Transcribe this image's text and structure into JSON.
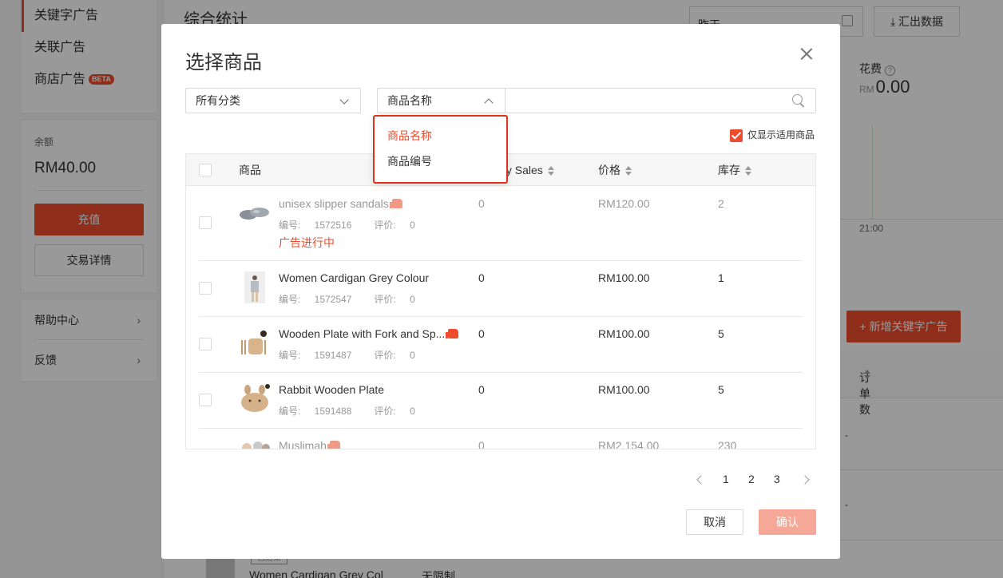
{
  "sidebar": {
    "nav": [
      {
        "label": "关键字广告"
      },
      {
        "label": "关联广告"
      },
      {
        "label": "商店广告",
        "badge": "BETA"
      }
    ],
    "balance_label": "余额",
    "balance_value": "RM40.00",
    "topup_label": "充值",
    "details_label": "交易详情",
    "help": [
      {
        "label": "帮助中心"
      },
      {
        "label": "反馈"
      }
    ]
  },
  "main": {
    "title": "综合统计",
    "date_value": "昨天",
    "export_label": "汇出数据",
    "spend_label": "花费",
    "spend_currency": "RM",
    "spend_value": "0.00",
    "chart_tick": "21:00",
    "add_keyword_ad": "+ 新增关键字广告",
    "orders_header": "订单数",
    "dash": "-",
    "bottom_row": {
      "status": "已结束",
      "name": "Women Cardigan Grey Col",
      "limit": "无限制"
    }
  },
  "modal": {
    "title": "选择商品",
    "category_select": "所有分类",
    "search_field_select": "商品名称",
    "search_placeholder": "",
    "dropdown_options": [
      "商品名称",
      "商品编号"
    ],
    "only_applicable_label": "仅显示适用商品",
    "columns": {
      "product": "商品",
      "sales": "hly Sales",
      "price": "价格",
      "stock": "库存"
    },
    "id_prefix": "编号: ",
    "rating_prefix": "评价: ",
    "rows": [
      {
        "name": "unisex slipper sandals",
        "id": "1572516",
        "rating": "0",
        "sales": "0",
        "price": "RM120.00",
        "stock": "2",
        "status": "广告进行中",
        "hot": true
      },
      {
        "name": "Women Cardigan Grey Colour",
        "id": "1572547",
        "rating": "0",
        "sales": "0",
        "price": "RM100.00",
        "stock": "1"
      },
      {
        "name": "Wooden Plate with Fork and Sp...",
        "id": "1591487",
        "rating": "0",
        "sales": "0",
        "price": "RM100.00",
        "stock": "5",
        "hot": true
      },
      {
        "name": "Rabbit Wooden Plate",
        "id": "1591488",
        "rating": "0",
        "sales": "0",
        "price": "RM100.00",
        "stock": "5"
      },
      {
        "name": "Muslimah",
        "sales": "0",
        "price": "RM2,154.00",
        "stock": "230",
        "hot": true
      }
    ],
    "pagination": {
      "pages": [
        "1",
        "2",
        "3"
      ],
      "current": "1"
    },
    "cancel_label": "取消",
    "confirm_label": "确认"
  }
}
